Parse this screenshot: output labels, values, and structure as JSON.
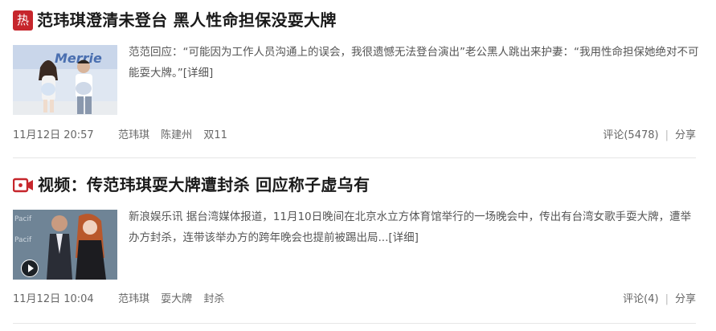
{
  "articles": [
    {
      "badge_text": "热",
      "badge_icon": "hot-badge-icon",
      "title": "范玮琪澄清未登台 黑人性命担保没耍大牌",
      "summary": "范范回应：“可能因为工作人员沟通上的误会，我很遗憾无法登台演出”老公黑人跳出来护妻：“我用性命担保她绝对不可能耍大牌。”",
      "more_label": "[详细]",
      "time": "11月12日 20:57",
      "tags": [
        "范玮琪",
        "陈建州",
        "双11"
      ],
      "comment_label": "评论(5478)",
      "share_label": "分享"
    },
    {
      "badge_icon": "video-camera-icon",
      "title": "视频：传范玮琪耍大牌遭封杀 回应称子虚乌有",
      "summary": "新浪娱乐讯 据台湾媒体报道，11月10日晚间在北京水立方体育馆举行的一场晚会中，传出有台湾女歌手耍大牌，遭举办方封杀，连带该举办方的跨年晚会也提前被踢出局...",
      "more_label": "[详细]",
      "time": "11月12日 10:04",
      "tags": [
        "范玮琪",
        "耍大牌",
        "封杀"
      ],
      "comment_label": "评论(4)",
      "share_label": "分享"
    }
  ],
  "colors": {
    "accent": "#c6262c",
    "divider": "#e6e6e6"
  }
}
